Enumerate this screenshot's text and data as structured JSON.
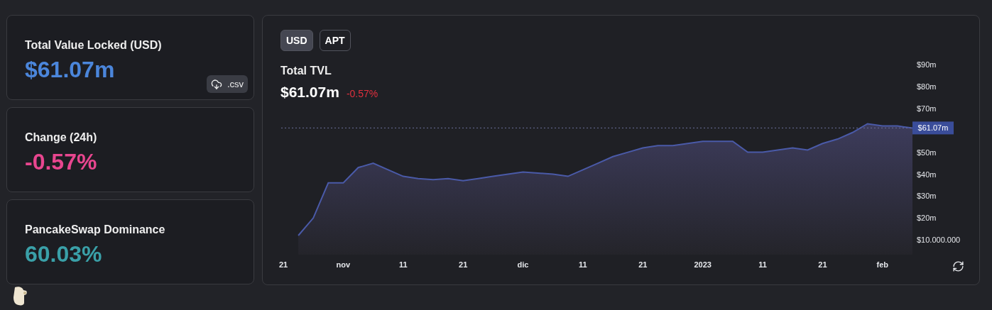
{
  "stat_cards": [
    {
      "label": "Total Value Locked (USD)",
      "value": "$61.07m",
      "color": "#4b86db",
      "button": ".csv"
    },
    {
      "label": "Change (24h)",
      "value": "-0.57%",
      "color": "#e8468f"
    },
    {
      "label": "PancakeSwap Dominance",
      "value": "60.03%",
      "color": "#3aa0a8"
    }
  ],
  "chart_panel": {
    "toggles": [
      {
        "label": "USD",
        "selected": true
      },
      {
        "label": "APT",
        "selected": false
      }
    ],
    "value": "$61.07m",
    "change": "-0.57%",
    "chart_data": {
      "type": "area",
      "title": "Total TVL",
      "categories": [
        "21",
        null,
        null,
        null,
        "nov",
        null,
        null,
        null,
        "11",
        null,
        null,
        null,
        "21",
        null,
        null,
        null,
        "dic",
        null,
        null,
        null,
        "11",
        null,
        null,
        null,
        "21",
        null,
        null,
        null,
        "2023",
        null,
        null,
        null,
        "11",
        null,
        null,
        null,
        "21",
        null,
        null,
        null,
        "feb",
        null,
        null
      ],
      "series": [
        {
          "color": "#4a5aa8",
          "values": [
            null,
            12000000,
            20000000,
            36000000,
            36000000,
            43000000,
            45000000,
            42000000,
            39000000,
            38000000,
            37500000,
            38000000,
            37000000,
            38000000,
            39000000,
            40000000,
            41000000,
            40500000,
            40000000,
            39000000,
            42000000,
            45000000,
            48000000,
            50000000,
            52000000,
            53000000,
            53000000,
            54000000,
            55000000,
            55000000,
            55000000,
            50000000,
            50000000,
            51000000,
            52000000,
            51000000,
            54000000,
            56000000,
            59000000,
            63000000,
            62000000,
            62000000,
            61000000
          ]
        }
      ],
      "yticks": [
        {
          "value": 10000000,
          "label": "$10.000.000"
        },
        {
          "value": 20000000,
          "label": "$20m"
        },
        {
          "value": 30000000,
          "label": "$30m"
        },
        {
          "value": 40000000,
          "label": "$40m"
        },
        {
          "value": 50000000,
          "label": "$50m"
        },
        {
          "value": 70000000,
          "label": "$70m"
        },
        {
          "value": 80000000,
          "label": "$80m"
        },
        {
          "value": 90000000,
          "label": "$90m"
        }
      ],
      "ylim": [
        10000000,
        90000000
      ],
      "ref_lines": [
        {
          "axis": "y",
          "value": 61070000,
          "label": "$61.07m"
        }
      ]
    }
  }
}
